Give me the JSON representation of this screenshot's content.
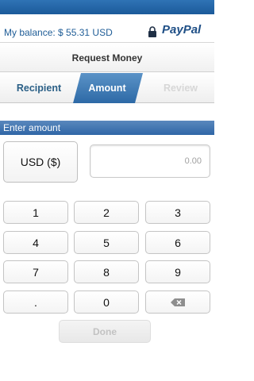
{
  "account": {
    "balance_text": "My balance: $ 55.31 USD",
    "brand": "PayPal"
  },
  "title": "Request Money",
  "steps": [
    {
      "label": "Recipient",
      "state": "done"
    },
    {
      "label": "Amount",
      "state": "active"
    },
    {
      "label": "Review",
      "state": "disabled"
    }
  ],
  "amount_section": {
    "header": "Enter amount",
    "currency_label": "USD ($)",
    "amount_placeholder": "0.00"
  },
  "keypad": {
    "keys": [
      "1",
      "2",
      "3",
      "4",
      "5",
      "6",
      "7",
      "8",
      "9",
      ".",
      "0"
    ],
    "backspace_icon": "backspace-icon"
  },
  "done_label": "Done",
  "icons": {
    "lock": "lock-icon",
    "backspace": "backspace-icon"
  },
  "colors": {
    "brand_blue": "#2f73b5",
    "step_active": "#3a74ae",
    "step_done": "#2a5f86",
    "step_disabled": "#d7d7d7"
  }
}
